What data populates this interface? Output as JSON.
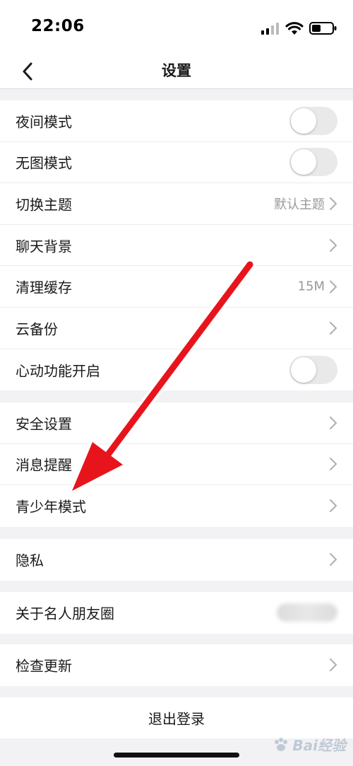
{
  "status_bar": {
    "time": "22:06"
  },
  "nav": {
    "title": "设置"
  },
  "groups": {
    "display": [
      {
        "label": "夜间模式",
        "type": "toggle"
      },
      {
        "label": "无图模式",
        "type": "toggle"
      },
      {
        "label": "切换主题",
        "value": "默认主题",
        "type": "link"
      },
      {
        "label": "聊天背景",
        "type": "link"
      },
      {
        "label": "清理缓存",
        "value": "15M",
        "type": "link"
      },
      {
        "label": "云备份",
        "type": "link"
      },
      {
        "label": "心动功能开启",
        "type": "toggle"
      }
    ],
    "security": [
      {
        "label": "安全设置"
      },
      {
        "label": "消息提醒"
      },
      {
        "label": "青少年模式"
      }
    ],
    "privacy": [
      {
        "label": "隐私"
      }
    ],
    "about": [
      {
        "label": "关于名人朋友圈"
      }
    ],
    "update": [
      {
        "label": "检查更新"
      }
    ]
  },
  "logout": {
    "label": "退出登录"
  },
  "watermark": {
    "text": "Bai经验"
  },
  "colors": {
    "arrow": "#e8141c",
    "toggle_off": "#e9e9ea",
    "background": "#f2f2f5"
  }
}
